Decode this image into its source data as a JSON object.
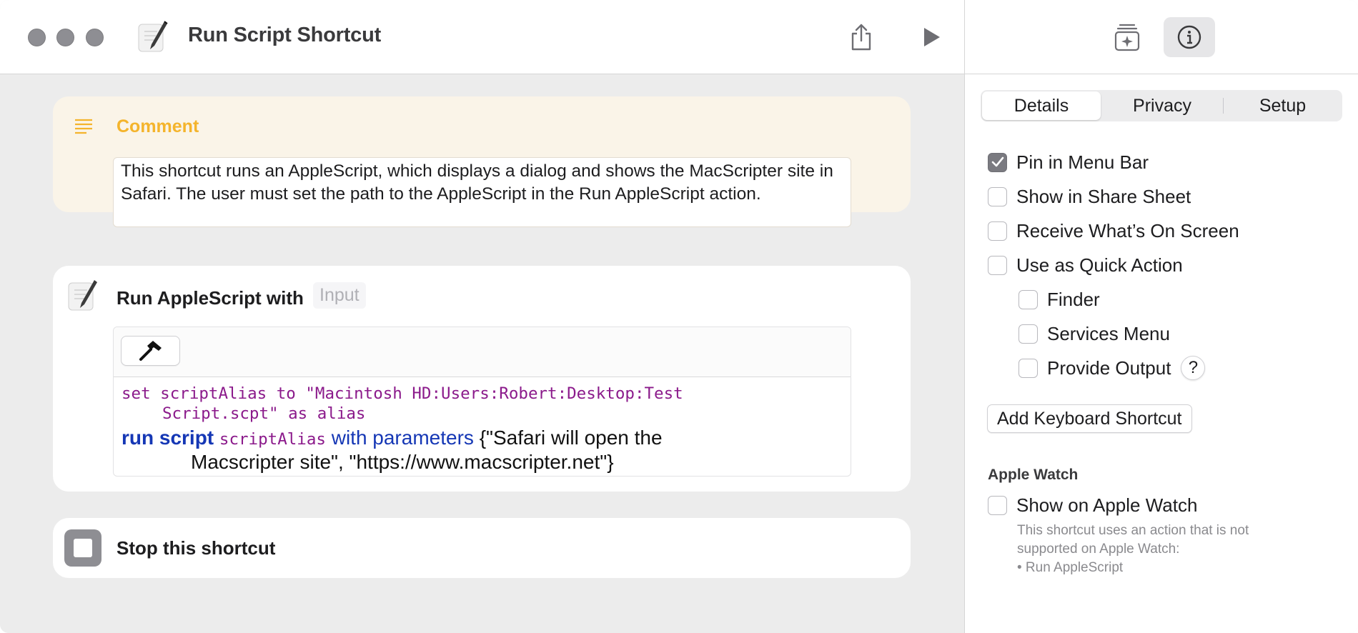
{
  "window": {
    "title": "Run Script Shortcut",
    "traffic_lights": [
      "close",
      "minimize",
      "zoom"
    ]
  },
  "toolbar": {
    "share_icon": "share-icon",
    "run_icon": "play-icon"
  },
  "actions": {
    "comment": {
      "label": "Comment",
      "text": "This shortcut runs an AppleScript, which displays a dialog and shows the MacScripter site in Safari. The user must set the path to the AppleScript in the Run AppleScript action."
    },
    "run_applescript": {
      "label": "Run AppleScript with",
      "input_token": "Input",
      "code": {
        "line1a": "set scriptAlias to \"Macintosh HD:Users:Robert:Desktop:Test",
        "line1b": "Script.scpt\" as alias",
        "run_keyword": "run script",
        "var": "scriptAlias",
        "with_params": "with parameters",
        "args_a": "{\"Safari will open the",
        "args_b": "Macscripter site\", \"https://www.macscripter.net\"}"
      }
    },
    "stop": {
      "label": "Stop this shortcut"
    }
  },
  "sidebar": {
    "tabs": [
      "Details",
      "Privacy",
      "Setup"
    ],
    "active_tab": "Details",
    "options": [
      {
        "label": "Pin in Menu Bar",
        "checked": true
      },
      {
        "label": "Show in Share Sheet",
        "checked": false
      },
      {
        "label": "Receive What’s On Screen",
        "checked": false
      },
      {
        "label": "Use as Quick Action",
        "checked": false
      }
    ],
    "quick_action_options": [
      {
        "label": "Finder",
        "checked": false
      },
      {
        "label": "Services Menu",
        "checked": false
      },
      {
        "label": "Provide Output",
        "checked": false
      }
    ],
    "help_label": "?",
    "add_shortcut_label": "Add Keyboard Shortcut",
    "apple_watch": {
      "heading": "Apple Watch",
      "option": "Show on Apple Watch",
      "note_line1": "This shortcut uses an action that is not",
      "note_line2": "supported on Apple Watch:",
      "note_line3": "• Run AppleScript"
    }
  },
  "colors": {
    "comment_accent": "#f4b42c",
    "keyword_blue": "#1537b5",
    "code_purple": "#8b1a8b",
    "comment_bg": "#faf4e8"
  }
}
